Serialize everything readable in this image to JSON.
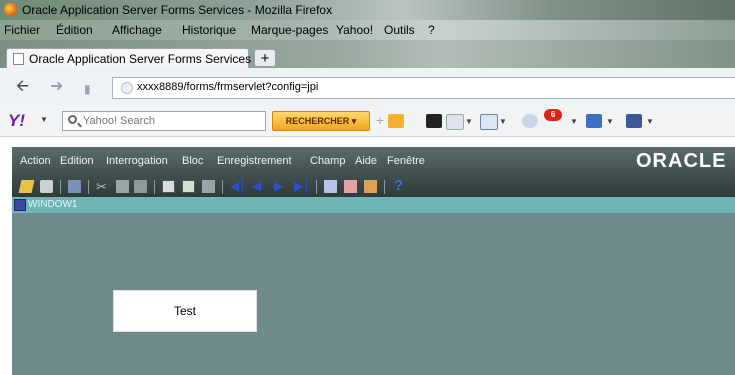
{
  "browser": {
    "window_title": "Oracle Application Server Forms Services - Mozilla Firefox",
    "menu": [
      "Fichier",
      "Édition",
      "Affichage",
      "Historique",
      "Marque-pages",
      "Yahoo!",
      "Outils",
      "?"
    ],
    "tab_title": "Oracle Application Server Forms Services",
    "new_tab_label": "+",
    "url": "xxxx8889/forms/frmservlet?config=jpi"
  },
  "yahoo_toolbar": {
    "logo": "Y!",
    "search_placeholder": "Yahoo! Search",
    "search_button": "RECHERCHER",
    "mail_count": "6"
  },
  "forms": {
    "menu": [
      "Action",
      "Edition",
      "Interrogation",
      "Bloc",
      "Enregistrement",
      "Champ",
      "Aide",
      "Fenêtre"
    ],
    "logo": "ORACLE",
    "help_label": "?",
    "window_title": "WINDOW1",
    "button_label": "Test"
  },
  "colors": {
    "forms_canvas": "#6f8a8a",
    "window_titlebar": "#6fb5b5",
    "yahoo_purple": "#6b1fa8"
  }
}
